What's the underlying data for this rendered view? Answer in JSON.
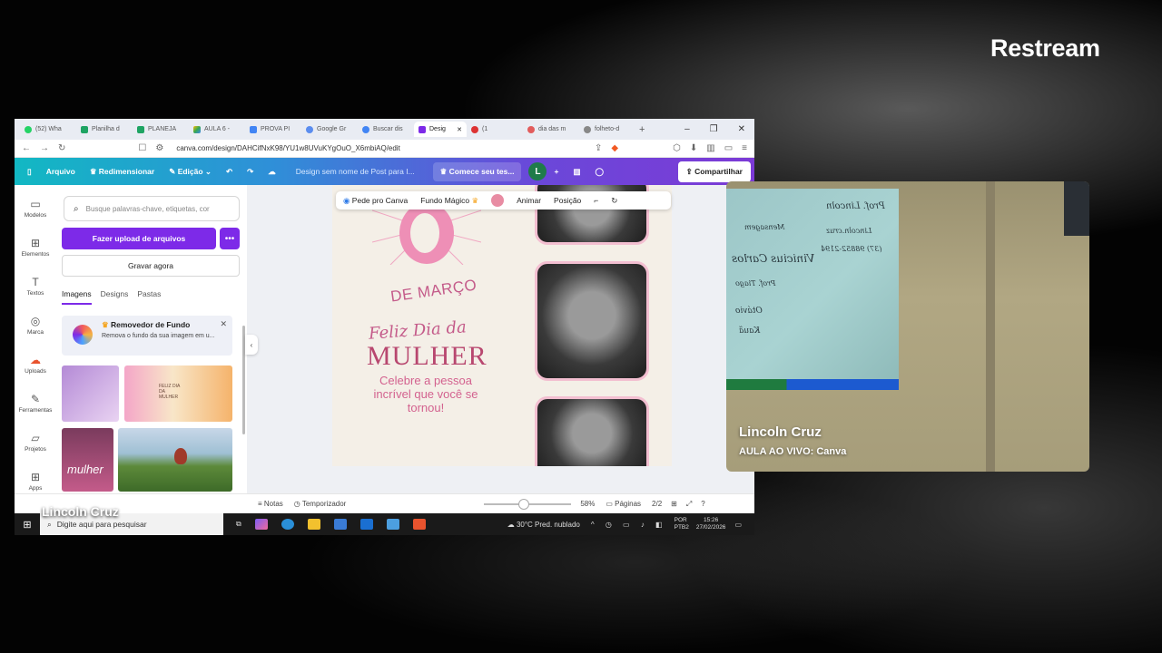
{
  "stream": {
    "brand": "Restream",
    "overlay_name": "Lincoln Cruz"
  },
  "browser": {
    "tabs": [
      "(52) Wha",
      "Planilha d",
      "PLANEJA",
      "AULA 6 -",
      "PROVA PI",
      "Google Gr",
      "Buscar dis",
      "Desig",
      "(1",
      "dia das m",
      "folheto-d"
    ],
    "active_tab_index": 7,
    "url": "canva.com/design/DAHCifNxK98/YU1w8UVuKYgOuO_X6mbiAQ/edit"
  },
  "canva": {
    "menu": {
      "file": "Arquivo",
      "resize": "Redimensionar",
      "edit": "Edição",
      "design_title": "Design sem nome de Post para I...",
      "trial": "Comece seu tes...",
      "avatar_letter": "L",
      "share": "Compartilhar"
    },
    "rail": [
      "Modelos",
      "Elementos",
      "Textos",
      "Marca",
      "Uploads",
      "Ferramentas",
      "Projetos",
      "Apps"
    ],
    "panel": {
      "search_placeholder": "Busque palavras-chave, etiquetas, cor",
      "upload_button": "Fazer upload de arquivos",
      "more_button": "•••",
      "record_button": "Gravar agora",
      "tabs": [
        "Imagens",
        "Designs",
        "Pastas"
      ],
      "promo_title": "Removedor de Fundo",
      "promo_text": "Remova o fundo da sua imagem em u..."
    },
    "toolbar": {
      "ask": "Pede pro Canva",
      "magic": "Fundo Mágico",
      "animate": "Animar",
      "position": "Posição"
    },
    "canvas": {
      "de_marco": "DE MARÇO",
      "feliz": "Feliz Dia da",
      "mulher": "MULHER",
      "message": "Celebre a pessoa incrível que você se tornou!"
    },
    "thumbs": {
      "t2_caption": "FELIZ DIA DA MULHER",
      "t3_caption": "mulher"
    },
    "status": {
      "notes": "Notas",
      "timer": "Temporizador",
      "zoom": "58%",
      "pages": "Páginas",
      "page_count": "2/2",
      "zoom_level": 0.58
    }
  },
  "taskbar": {
    "search": "Digite aqui para pesquisar",
    "weather": "30°C  Pred. nublado",
    "lang1": "POR",
    "lang2": "PTB2",
    "time": "15:26",
    "date": "27/02/2026"
  },
  "camera": {
    "name": "Lincoln Cruz",
    "subtitle": "AULA AO VIVO: Canva",
    "board_lines": [
      "Prof. Lincoln",
      "Lincoln.cruz",
      "(37) 98852-2194",
      "Mensagem",
      "Vinicius Carlos",
      "Prof. Tiago",
      "Otávio",
      "Kauã"
    ]
  }
}
